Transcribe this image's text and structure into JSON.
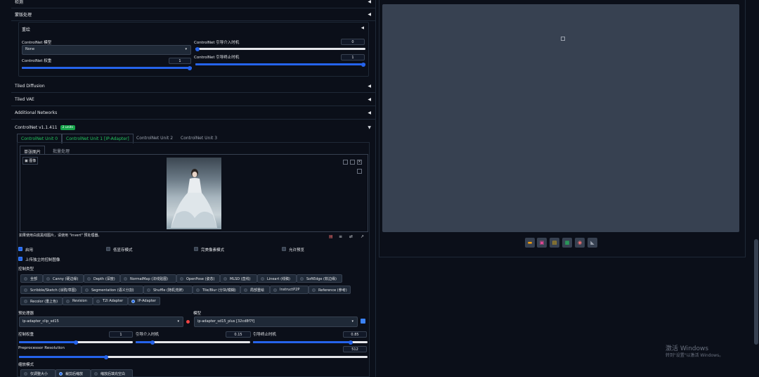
{
  "left": {
    "accordions_top": [
      {
        "label": "检测",
        "arrow": "◀"
      },
      {
        "label": "蒙版处理",
        "arrow": "◀"
      }
    ],
    "redraw": {
      "title": "重绘",
      "arrow": "◀",
      "cn_model_label": "ControlNet 模型",
      "cn_model_value": "None",
      "cn_weight_label": "ControlNet 权重",
      "cn_weight_value": "1",
      "cn_weight_level": 1.0,
      "cn_start_label": "ControlNet 引导介入时机",
      "cn_start_value": "0",
      "cn_start_level": 0.0,
      "cn_end_label": "ControlNet 引导终止时机",
      "cn_end_value": "1",
      "cn_end_level": 1.0
    },
    "accordions_mid": [
      {
        "label": "Tiled Diffusion",
        "arrow": "◀"
      },
      {
        "label": "Tiled VAE",
        "arrow": "◀"
      },
      {
        "label": "Additional Networks",
        "arrow": "◀"
      }
    ],
    "controlnet": {
      "title": "ControlNet v1.1.411",
      "badge": "2 units",
      "arrow": "▼",
      "units": [
        "ControlNet Unit 0",
        "ControlNet Unit 1 [IP-Adapter]",
        "ControlNet Unit 2",
        "ControlNet Unit 3"
      ],
      "image_tabs": [
        "单张图片",
        "批量处理"
      ],
      "image_label": "图像",
      "hint": "如果使用白底黑线图片，请使用 \"invert\" 预处理器。",
      "checks": [
        {
          "label": "启用",
          "on": true
        },
        {
          "label": "低显存模式",
          "on": false
        },
        {
          "label": "完美像素模式",
          "on": false
        },
        {
          "label": "允许预览",
          "on": false
        }
      ],
      "upload_check": "上传独立的控制图像",
      "control_type_label": "控制类型",
      "control_types_row1": [
        "全部",
        "Canny (硬边缘)",
        "Depth (深度)",
        "NormalMap (法线贴图)",
        "OpenPose (姿态)",
        "MLSD (直线)",
        "Lineart (线稿)",
        "SoftEdge (软边缘)"
      ],
      "control_types_row2": [
        "Scribble/Sketch (涂鸦/草图)",
        "Segmentation (语义分割)",
        "Shuffle (随机洗牌)",
        "Tile/Blur (分块/模糊)",
        "局部重绘",
        "InstructP2P",
        "Reference (参考)"
      ],
      "control_types_row3": [
        "Recolor (重上色)",
        "Revision",
        "T2I Adapter",
        "IP-Adapter"
      ],
      "selected_type": "IP-Adapter",
      "preprocessor_label": "预处理器",
      "preprocessor_value": "ip-adapter_clip_sd15",
      "model_label": "模型",
      "model_value": "ip-adapter_sd15_plus [32cd8f7f]",
      "weight_label": "控制权重",
      "weight_value": "1",
      "start_label": "引导介入时机",
      "start_value": "0.15",
      "end_label": "引导终止时机",
      "end_value": "0.85",
      "weight_level": 0.5,
      "start_level": 0.15,
      "end_level": 0.85,
      "prep_res_label": "Preprocessor Resolution",
      "prep_res_value": "512",
      "prep_res_level": 0.25,
      "resize_label": "缩放模式",
      "resize_options": [
        "仅调整大小",
        "裁剪后缩放",
        "缩放后填充空白"
      ],
      "resize_selected": "裁剪后缩放"
    }
  },
  "right": {
    "output_buttons": [
      "folder-icon",
      "save-icon",
      "zip-icon",
      "image-icon",
      "palette-icon",
      "ruler-icon"
    ]
  },
  "watermark": {
    "title": "激活 Windows",
    "sub": "转到\"设置\"以激活 Windows。"
  },
  "colors": {
    "bg": "#0b0f19",
    "accent": "#2563eb",
    "green": "#22c55e",
    "panel": "#374151"
  }
}
